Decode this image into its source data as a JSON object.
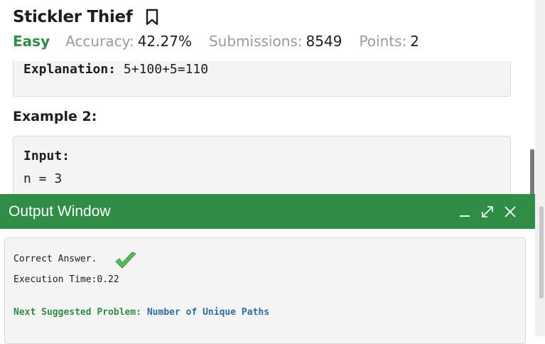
{
  "problem": {
    "title": "Stickler Thief",
    "difficulty": "Easy",
    "accuracy_label": "Accuracy:",
    "accuracy_value": "42.27%",
    "submissions_label": "Submissions:",
    "submissions_value": "8549",
    "points_label": "Points:",
    "points_value": "2"
  },
  "content": {
    "explanation_key": "Explanation:",
    "explanation_value": "5+100+5=110",
    "example2_heading": "Example 2:",
    "input_key": "Input:",
    "input_value": "n = 3"
  },
  "output_window": {
    "title": "Output Window",
    "result_text": "Correct Answer.",
    "execution_time": "Execution Time:0.22",
    "next_label": "Next Suggested Problem:",
    "next_problem": "Number of Unique Paths"
  },
  "colors": {
    "accent_green": "#2f8d46",
    "link_blue": "#2e6da4",
    "check_green": "#5cb85c"
  }
}
